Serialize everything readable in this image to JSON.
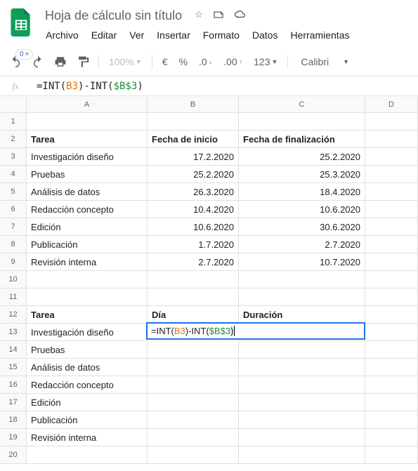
{
  "doc": {
    "title": "Hoja de cálculo sin título"
  },
  "menu": [
    "Archivo",
    "Editar",
    "Ver",
    "Insertar",
    "Formato",
    "Datos",
    "Herramientas"
  ],
  "toolbar": {
    "undo_badge": "0",
    "zoom": "100%",
    "currency": "€",
    "percent": "%",
    "dec_dec": ".0",
    "inc_dec": ".00",
    "format_num": "123",
    "font": "Calibri"
  },
  "formula": {
    "prefix": "=INT(",
    "ref1": "B3",
    "mid": ")-INT(",
    "ref2": "$B$3",
    "suffix": ")"
  },
  "columns": [
    "A",
    "B",
    "C",
    "D"
  ],
  "rows": [
    "1",
    "2",
    "3",
    "4",
    "5",
    "6",
    "7",
    "8",
    "9",
    "10",
    "11",
    "12",
    "13",
    "14",
    "15",
    "16",
    "17",
    "18",
    "19",
    "20"
  ],
  "headers1": {
    "a": "Tarea",
    "b": "Fecha de inicio",
    "c": "Fecha de finalización"
  },
  "table1": [
    {
      "a": "Investigación diseño",
      "b": "17.2.2020",
      "c": "25.2.2020"
    },
    {
      "a": "Pruebas",
      "b": "25.2.2020",
      "c": "25.3.2020"
    },
    {
      "a": "Análisis de datos",
      "b": "26.3.2020",
      "c": "18.4.2020"
    },
    {
      "a": "Redacción concepto",
      "b": "10.4.2020",
      "c": "10.6.2020"
    },
    {
      "a": "Edición",
      "b": "10.6.2020",
      "c": "30.6.2020"
    },
    {
      "a": "Publicación",
      "b": "1.7.2020",
      "c": "2.7.2020"
    },
    {
      "a": "Revisión interna",
      "b": "2.7.2020",
      "c": "10.7.2020"
    }
  ],
  "headers2": {
    "a": "Tarea",
    "b": "Día",
    "c": "Duración"
  },
  "table2": [
    {
      "a": "Investigación diseño"
    },
    {
      "a": "Pruebas"
    },
    {
      "a": "Análisis de datos"
    },
    {
      "a": "Redacción concepto"
    },
    {
      "a": "Edición"
    },
    {
      "a": "Publicación"
    },
    {
      "a": "Revisión interna"
    }
  ]
}
